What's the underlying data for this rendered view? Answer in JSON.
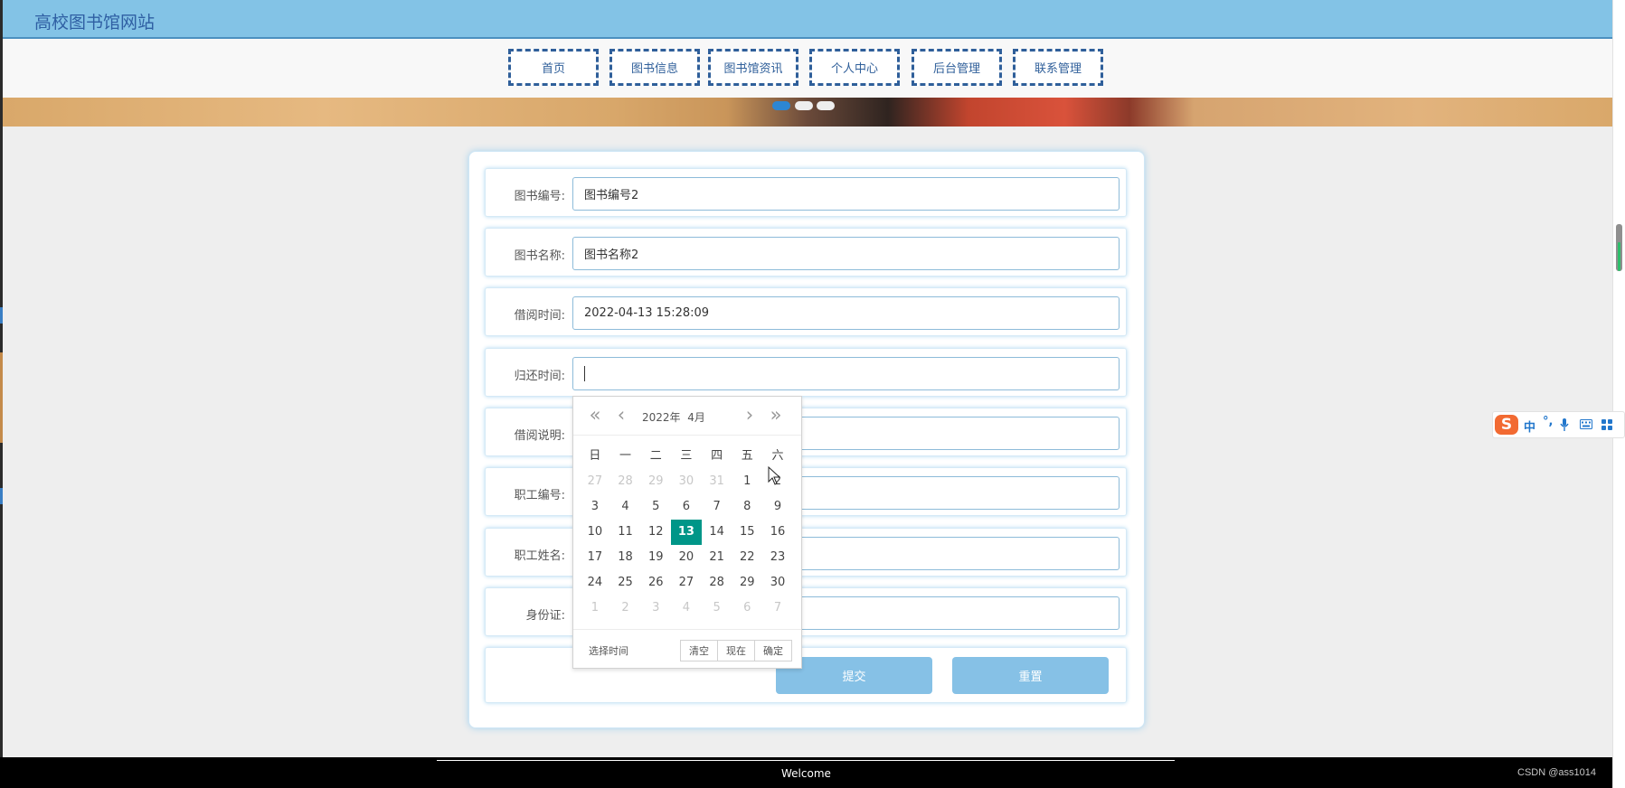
{
  "site": {
    "title": "高校图书馆网站"
  },
  "nav": {
    "items": [
      {
        "label": "首页"
      },
      {
        "label": "图书信息"
      },
      {
        "label": "图书馆资讯"
      },
      {
        "label": "个人中心"
      },
      {
        "label": "后台管理"
      },
      {
        "label": "联系管理"
      }
    ]
  },
  "banner": {
    "slide_count": 3,
    "active_slide": 1
  },
  "form": {
    "fields": [
      {
        "label": "图书编号:",
        "value": "图书编号2"
      },
      {
        "label": "图书名称:",
        "value": "图书名称2"
      },
      {
        "label": "借阅时间:",
        "value": "2022-04-13 15:28:09"
      },
      {
        "label": "归还时间:",
        "value": ""
      },
      {
        "label": "借阅说明:",
        "value": ""
      },
      {
        "label": "职工编号:",
        "value": ""
      },
      {
        "label": "职工姓名:",
        "value": ""
      },
      {
        "label": "身份证:",
        "value": ""
      }
    ],
    "submit_label": "提交",
    "reset_label": "重置"
  },
  "datepicker": {
    "year_label": "2022年",
    "month_label": "4月",
    "weekdays": [
      "日",
      "一",
      "二",
      "三",
      "四",
      "五",
      "六"
    ],
    "weeks": [
      [
        {
          "d": "27",
          "o": true
        },
        {
          "d": "28",
          "o": true
        },
        {
          "d": "29",
          "o": true
        },
        {
          "d": "30",
          "o": true
        },
        {
          "d": "31",
          "o": true
        },
        {
          "d": "1"
        },
        {
          "d": "2"
        }
      ],
      [
        {
          "d": "3"
        },
        {
          "d": "4"
        },
        {
          "d": "5"
        },
        {
          "d": "6"
        },
        {
          "d": "7"
        },
        {
          "d": "8"
        },
        {
          "d": "9"
        }
      ],
      [
        {
          "d": "10"
        },
        {
          "d": "11"
        },
        {
          "d": "12"
        },
        {
          "d": "13",
          "s": true
        },
        {
          "d": "14"
        },
        {
          "d": "15"
        },
        {
          "d": "16"
        }
      ],
      [
        {
          "d": "17"
        },
        {
          "d": "18"
        },
        {
          "d": "19"
        },
        {
          "d": "20"
        },
        {
          "d": "21"
        },
        {
          "d": "22"
        },
        {
          "d": "23"
        }
      ],
      [
        {
          "d": "24"
        },
        {
          "d": "25"
        },
        {
          "d": "26"
        },
        {
          "d": "27"
        },
        {
          "d": "28"
        },
        {
          "d": "29"
        },
        {
          "d": "30"
        }
      ],
      [
        {
          "d": "1",
          "o": true
        },
        {
          "d": "2",
          "o": true
        },
        {
          "d": "3",
          "o": true
        },
        {
          "d": "4",
          "o": true
        },
        {
          "d": "5",
          "o": true
        },
        {
          "d": "6",
          "o": true
        },
        {
          "d": "7",
          "o": true
        }
      ]
    ],
    "select_time_label": "选择时间",
    "clear_label": "清空",
    "now_label": "现在",
    "confirm_label": "确定"
  },
  "ime": {
    "logo": "S",
    "mode": "中",
    "punct": "°,"
  },
  "footer": {
    "text": "Welcome"
  },
  "watermark": "CSDN @ass1014",
  "colors": {
    "header": "#83c3e6",
    "nav_border": "#2f5f9a",
    "button": "#86c1e6",
    "selected_day": "#009688"
  }
}
